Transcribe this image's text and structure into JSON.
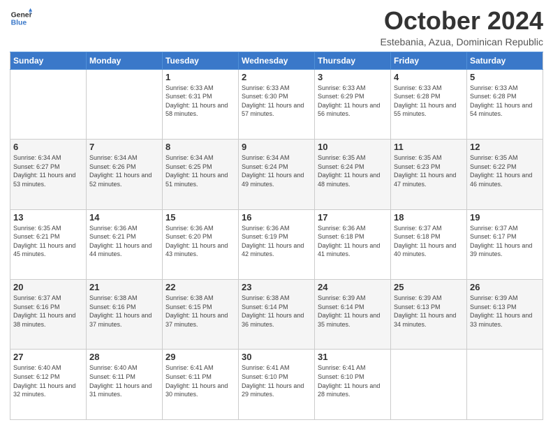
{
  "header": {
    "logo_line1": "General",
    "logo_line2": "Blue",
    "month": "October 2024",
    "location": "Estebania, Azua, Dominican Republic"
  },
  "days_of_week": [
    "Sunday",
    "Monday",
    "Tuesday",
    "Wednesday",
    "Thursday",
    "Friday",
    "Saturday"
  ],
  "weeks": [
    [
      {
        "day": "",
        "sunrise": "",
        "sunset": "",
        "daylight": ""
      },
      {
        "day": "",
        "sunrise": "",
        "sunset": "",
        "daylight": ""
      },
      {
        "day": "1",
        "sunrise": "Sunrise: 6:33 AM",
        "sunset": "Sunset: 6:31 PM",
        "daylight": "Daylight: 11 hours and 58 minutes."
      },
      {
        "day": "2",
        "sunrise": "Sunrise: 6:33 AM",
        "sunset": "Sunset: 6:30 PM",
        "daylight": "Daylight: 11 hours and 57 minutes."
      },
      {
        "day": "3",
        "sunrise": "Sunrise: 6:33 AM",
        "sunset": "Sunset: 6:29 PM",
        "daylight": "Daylight: 11 hours and 56 minutes."
      },
      {
        "day": "4",
        "sunrise": "Sunrise: 6:33 AM",
        "sunset": "Sunset: 6:28 PM",
        "daylight": "Daylight: 11 hours and 55 minutes."
      },
      {
        "day": "5",
        "sunrise": "Sunrise: 6:33 AM",
        "sunset": "Sunset: 6:28 PM",
        "daylight": "Daylight: 11 hours and 54 minutes."
      }
    ],
    [
      {
        "day": "6",
        "sunrise": "Sunrise: 6:34 AM",
        "sunset": "Sunset: 6:27 PM",
        "daylight": "Daylight: 11 hours and 53 minutes."
      },
      {
        "day": "7",
        "sunrise": "Sunrise: 6:34 AM",
        "sunset": "Sunset: 6:26 PM",
        "daylight": "Daylight: 11 hours and 52 minutes."
      },
      {
        "day": "8",
        "sunrise": "Sunrise: 6:34 AM",
        "sunset": "Sunset: 6:25 PM",
        "daylight": "Daylight: 11 hours and 51 minutes."
      },
      {
        "day": "9",
        "sunrise": "Sunrise: 6:34 AM",
        "sunset": "Sunset: 6:24 PM",
        "daylight": "Daylight: 11 hours and 49 minutes."
      },
      {
        "day": "10",
        "sunrise": "Sunrise: 6:35 AM",
        "sunset": "Sunset: 6:24 PM",
        "daylight": "Daylight: 11 hours and 48 minutes."
      },
      {
        "day": "11",
        "sunrise": "Sunrise: 6:35 AM",
        "sunset": "Sunset: 6:23 PM",
        "daylight": "Daylight: 11 hours and 47 minutes."
      },
      {
        "day": "12",
        "sunrise": "Sunrise: 6:35 AM",
        "sunset": "Sunset: 6:22 PM",
        "daylight": "Daylight: 11 hours and 46 minutes."
      }
    ],
    [
      {
        "day": "13",
        "sunrise": "Sunrise: 6:35 AM",
        "sunset": "Sunset: 6:21 PM",
        "daylight": "Daylight: 11 hours and 45 minutes."
      },
      {
        "day": "14",
        "sunrise": "Sunrise: 6:36 AM",
        "sunset": "Sunset: 6:21 PM",
        "daylight": "Daylight: 11 hours and 44 minutes."
      },
      {
        "day": "15",
        "sunrise": "Sunrise: 6:36 AM",
        "sunset": "Sunset: 6:20 PM",
        "daylight": "Daylight: 11 hours and 43 minutes."
      },
      {
        "day": "16",
        "sunrise": "Sunrise: 6:36 AM",
        "sunset": "Sunset: 6:19 PM",
        "daylight": "Daylight: 11 hours and 42 minutes."
      },
      {
        "day": "17",
        "sunrise": "Sunrise: 6:36 AM",
        "sunset": "Sunset: 6:18 PM",
        "daylight": "Daylight: 11 hours and 41 minutes."
      },
      {
        "day": "18",
        "sunrise": "Sunrise: 6:37 AM",
        "sunset": "Sunset: 6:18 PM",
        "daylight": "Daylight: 11 hours and 40 minutes."
      },
      {
        "day": "19",
        "sunrise": "Sunrise: 6:37 AM",
        "sunset": "Sunset: 6:17 PM",
        "daylight": "Daylight: 11 hours and 39 minutes."
      }
    ],
    [
      {
        "day": "20",
        "sunrise": "Sunrise: 6:37 AM",
        "sunset": "Sunset: 6:16 PM",
        "daylight": "Daylight: 11 hours and 38 minutes."
      },
      {
        "day": "21",
        "sunrise": "Sunrise: 6:38 AM",
        "sunset": "Sunset: 6:16 PM",
        "daylight": "Daylight: 11 hours and 37 minutes."
      },
      {
        "day": "22",
        "sunrise": "Sunrise: 6:38 AM",
        "sunset": "Sunset: 6:15 PM",
        "daylight": "Daylight: 11 hours and 37 minutes."
      },
      {
        "day": "23",
        "sunrise": "Sunrise: 6:38 AM",
        "sunset": "Sunset: 6:14 PM",
        "daylight": "Daylight: 11 hours and 36 minutes."
      },
      {
        "day": "24",
        "sunrise": "Sunrise: 6:39 AM",
        "sunset": "Sunset: 6:14 PM",
        "daylight": "Daylight: 11 hours and 35 minutes."
      },
      {
        "day": "25",
        "sunrise": "Sunrise: 6:39 AM",
        "sunset": "Sunset: 6:13 PM",
        "daylight": "Daylight: 11 hours and 34 minutes."
      },
      {
        "day": "26",
        "sunrise": "Sunrise: 6:39 AM",
        "sunset": "Sunset: 6:13 PM",
        "daylight": "Daylight: 11 hours and 33 minutes."
      }
    ],
    [
      {
        "day": "27",
        "sunrise": "Sunrise: 6:40 AM",
        "sunset": "Sunset: 6:12 PM",
        "daylight": "Daylight: 11 hours and 32 minutes."
      },
      {
        "day": "28",
        "sunrise": "Sunrise: 6:40 AM",
        "sunset": "Sunset: 6:11 PM",
        "daylight": "Daylight: 11 hours and 31 minutes."
      },
      {
        "day": "29",
        "sunrise": "Sunrise: 6:41 AM",
        "sunset": "Sunset: 6:11 PM",
        "daylight": "Daylight: 11 hours and 30 minutes."
      },
      {
        "day": "30",
        "sunrise": "Sunrise: 6:41 AM",
        "sunset": "Sunset: 6:10 PM",
        "daylight": "Daylight: 11 hours and 29 minutes."
      },
      {
        "day": "31",
        "sunrise": "Sunrise: 6:41 AM",
        "sunset": "Sunset: 6:10 PM",
        "daylight": "Daylight: 11 hours and 28 minutes."
      },
      {
        "day": "",
        "sunrise": "",
        "sunset": "",
        "daylight": ""
      },
      {
        "day": "",
        "sunrise": "",
        "sunset": "",
        "daylight": ""
      }
    ]
  ]
}
